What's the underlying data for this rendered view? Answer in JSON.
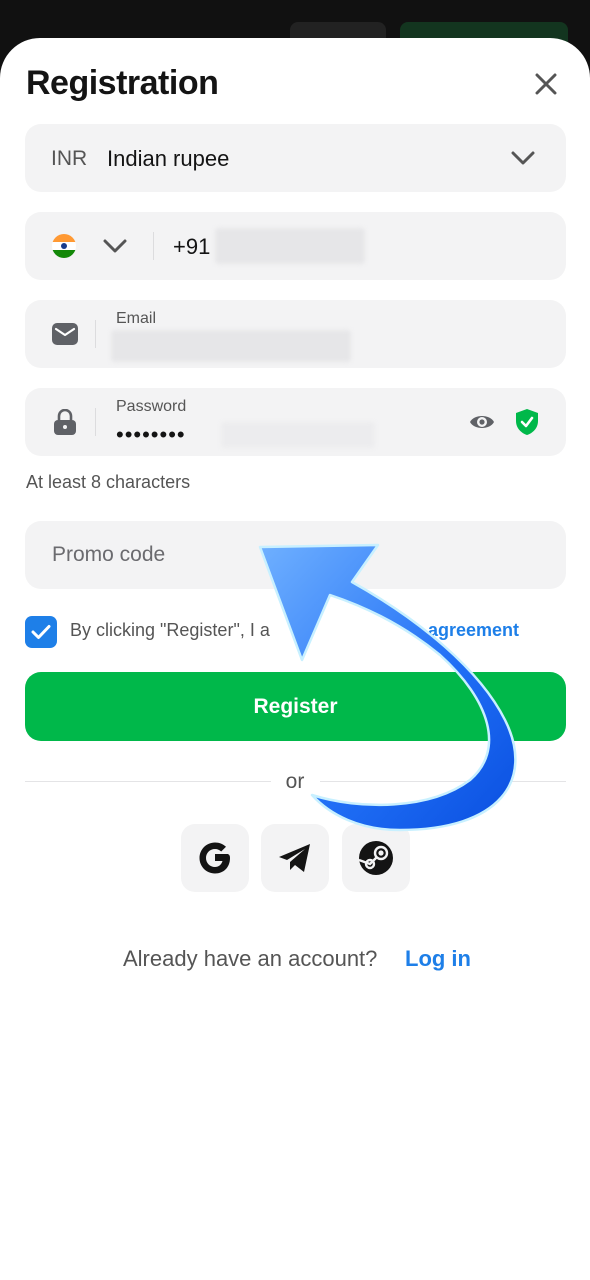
{
  "form": {
    "title": "Registration",
    "currency": {
      "code": "INR",
      "name": "Indian rupee"
    },
    "phone": {
      "country_flag": "india-flag-icon",
      "prefix": "+91"
    },
    "email": {
      "label": "Email"
    },
    "password": {
      "label": "Password",
      "value": "••••••••",
      "hint": "At least 8 characters"
    },
    "promo": {
      "placeholder": "Promo code"
    },
    "agreement": {
      "checked": true,
      "text": "By clicking \"Register\", I a",
      "link": "agreement"
    },
    "register_label": "Register",
    "divider_text": "or",
    "social": [
      "google-icon",
      "telegram-icon",
      "steam-icon"
    ],
    "footer": {
      "prompt": "Already have an account?",
      "login_label": "Log in"
    }
  },
  "colors": {
    "accent": "#1e7fe8",
    "primary_button": "#00b84a",
    "field_bg": "#f3f3f4",
    "shield": "#00b84a"
  }
}
